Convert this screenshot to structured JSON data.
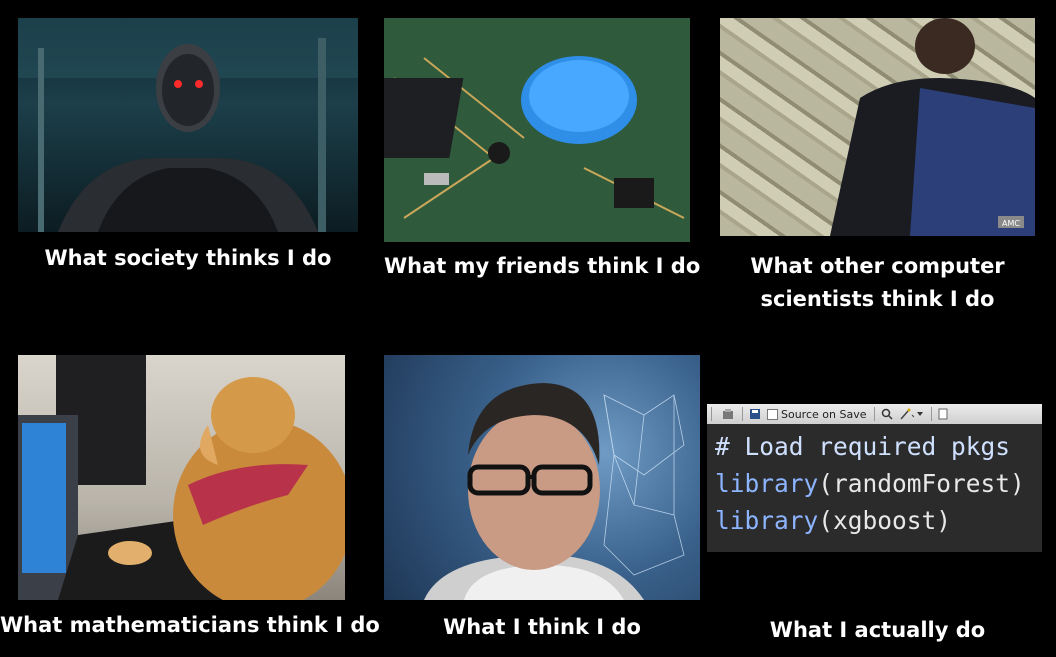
{
  "panels": [
    {
      "caption": "What society thinks I do"
    },
    {
      "caption": "What my friends think I do"
    },
    {
      "caption_line1": "What other computer",
      "caption_line2": "scientists think I do"
    },
    {
      "caption": "What mathematicians think I do"
    },
    {
      "caption": "What I think I do"
    },
    {
      "caption": "What I actually do"
    }
  ],
  "editor": {
    "source_on_save": "Source on Save",
    "line1": "# Load required pkgs",
    "line2_fn": "library",
    "line2_arg": "(randomForest)",
    "line3_fn": "library",
    "line3_arg": "(xgboost)"
  },
  "watermark": "AMC"
}
